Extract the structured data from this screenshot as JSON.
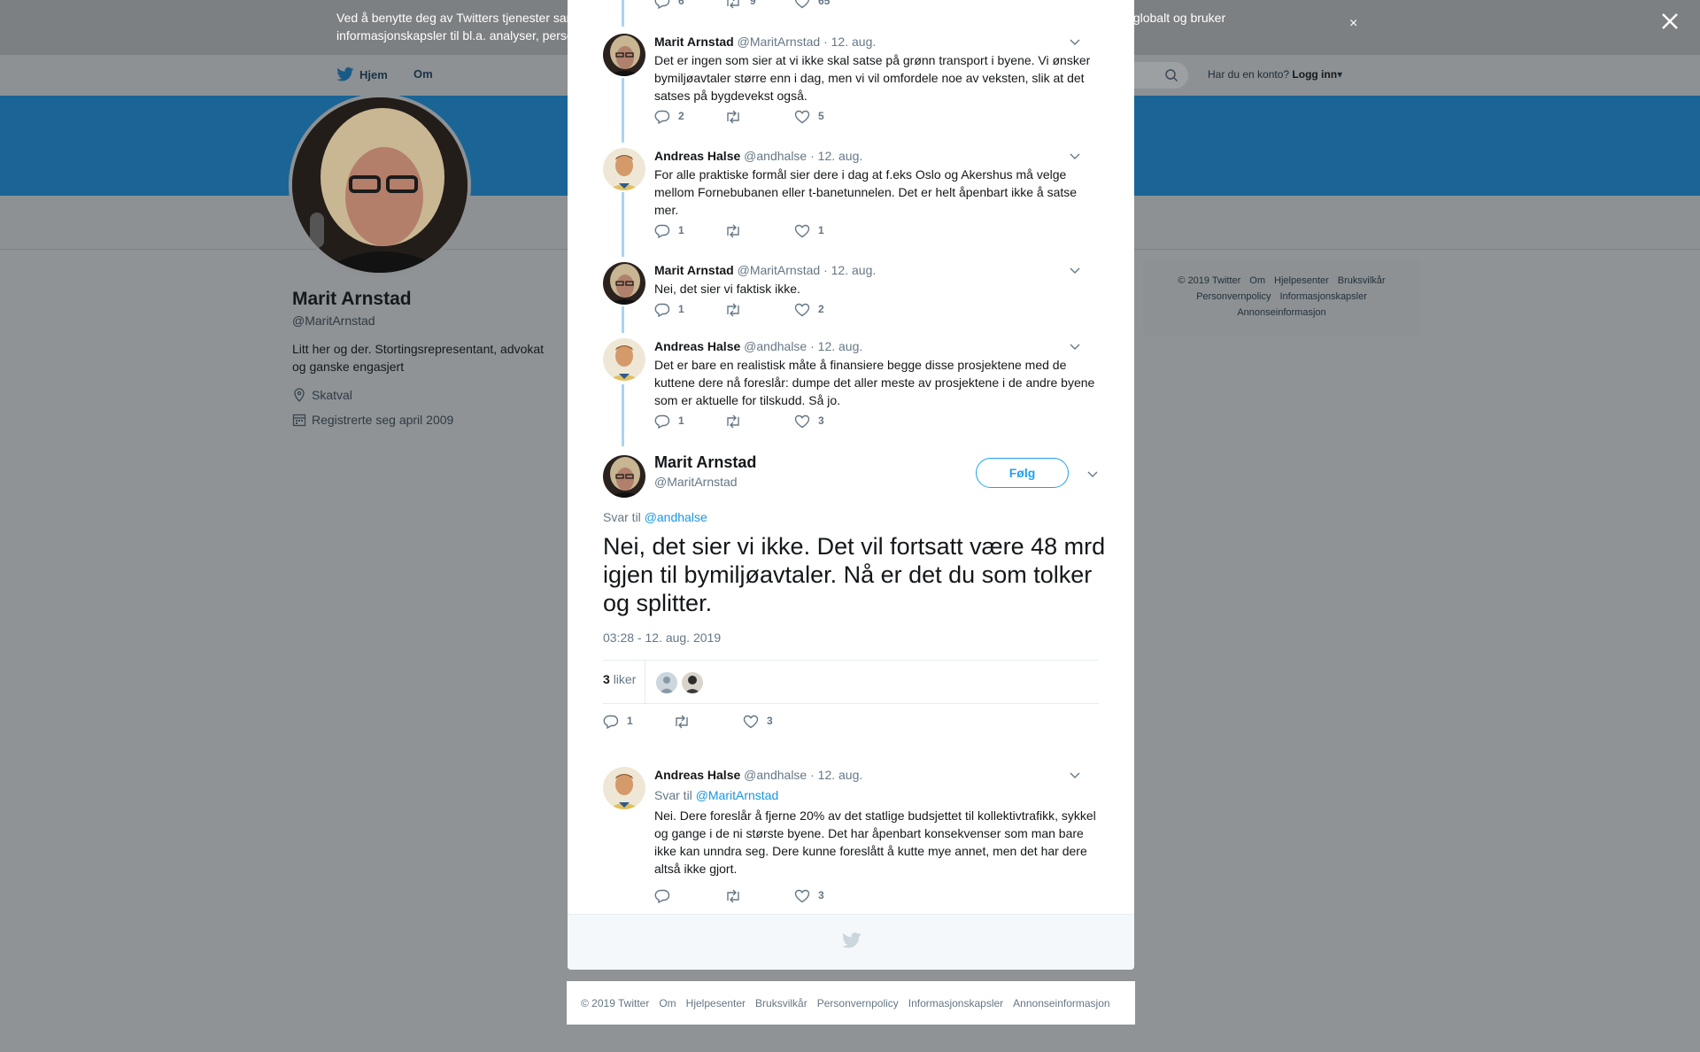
{
  "background": {
    "cookie_text": "Ved å benytte deg av Twitters tjenester samtykker du i vår bruk av informasjonskapsler og datadeling med tredjeparter. Vi og våre partnere driver globalt og bruker informasjonskapsler til bl.a. analyser, personalisering og annonser.",
    "cookie_close": "×",
    "nav": {
      "home": "Hjem",
      "about": "Om"
    },
    "login_question": "Har du en konto?",
    "login_link": "Logg inn",
    "profile": {
      "name": "Marit Arnstad",
      "handle": "@MaritArnstad",
      "bio": "Litt her og der. Stortingsrepresentant, advokat og ganske engasjert",
      "location": "Skatval",
      "joined": "Registrerte seg april 2009"
    },
    "side_footer": [
      "© 2019 Twitter",
      "Om",
      "Hjelpesenter",
      "Bruksvilkår",
      "Personvernpolicy",
      "Informasjonskapsler",
      "Annonseinformasjon"
    ]
  },
  "top_partial_actions": {
    "replies": "6",
    "retweets": "9",
    "likes": "65"
  },
  "thread": [
    {
      "name": "Marit Arnstad",
      "handle": "@MaritArnstad",
      "sep": "·",
      "date": "12. aug.",
      "text": "Det er ingen som sier at vi ikke skal satse på grønn transport i byene. Vi ønsker bymiljøavtaler større enn i dag, men vi vil omfordele noe av veksten, slik at det satses på bygdevekst også.",
      "replies": "2",
      "retweets": "",
      "likes": "5"
    },
    {
      "name": "Andreas Halse",
      "handle": "@andhalse",
      "sep": "·",
      "date": "12. aug.",
      "text": "For alle praktiske formål sier dere i dag at f.eks Oslo og Akershus må velge mellom Fornebubanen eller t-banetunnelen. Det er helt åpenbart ikke å satse mer.",
      "replies": "1",
      "retweets": "",
      "likes": "1"
    },
    {
      "name": "Marit Arnstad",
      "handle": "@MaritArnstad",
      "sep": "·",
      "date": "12. aug.",
      "text": "Nei, det sier vi faktisk ikke.",
      "replies": "1",
      "retweets": "",
      "likes": "2"
    },
    {
      "name": "Andreas Halse",
      "handle": "@andhalse",
      "sep": "·",
      "date": "12. aug.",
      "text": "Det er bare en realistisk måte å finansiere begge disse prosjektene med de kuttene dere nå foreslår: dumpe det aller meste av prosjektene i de andre byene som er aktuelle for tilskudd. Så jo.",
      "replies": "1",
      "retweets": "",
      "likes": "3"
    }
  ],
  "main_tweet": {
    "name": "Marit Arnstad",
    "handle": "@MaritArnstad",
    "follow_label": "Følg",
    "reply_prefix": "Svar til",
    "reply_to": "@andhalse",
    "text": "Nei, det sier vi ikke. Det vil fortsatt være 48 mrd igjen til bymiljøavtaler.  Nå er det du som tolker og splitter.",
    "timestamp": "03:28 - 12. aug. 2019",
    "likes_count": "3",
    "likes_label": "liker",
    "replies": "1",
    "retweets": "",
    "likes": "3"
  },
  "reply": {
    "name": "Andreas Halse",
    "handle": "@andhalse",
    "sep": "·",
    "date": "12. aug.",
    "reply_prefix": "Svar til",
    "reply_to": "@MaritArnstad",
    "text": "Nei. Dere foreslår å fjerne 20% av det statlige budsjettet til kollektivtrafikk, sykkel og gange i de ni største byene. Det har åpenbart konsekvenser som man bare ikke kan unndra seg. Dere kunne foreslått å kutte mye annet, men det har dere altså ikke gjort.",
    "replies": "",
    "retweets": "",
    "likes": "3"
  },
  "bottom_footer": [
    "© 2019 Twitter",
    "Om",
    "Hjelpesenter",
    "Bruksvilkår",
    "Personvernpolicy",
    "Informasjonskapsler",
    "Annonseinformasjon"
  ],
  "colors": {
    "accent": "#1da1f2",
    "link": "#1b95e0",
    "thread_line": "#a9d4f2",
    "overlay": "#8f9396"
  }
}
